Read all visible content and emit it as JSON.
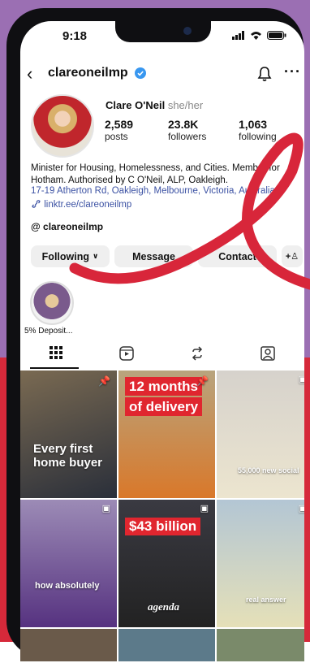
{
  "status_bar": {
    "time": "9:18"
  },
  "header": {
    "username": "clareoneilmp"
  },
  "profile": {
    "display_name": "Clare O'Neil",
    "pronouns": "she/her",
    "posts_count": "2,589",
    "posts_label": "posts",
    "followers_count": "23.8K",
    "followers_label": "followers",
    "following_count": "1,063",
    "following_label": "following",
    "bio_line1": "Minister for Housing, Homelessness, and Cities. Member for",
    "bio_line2": "Hotham. Authorised by C O'Neil, ALP, Oakleigh.",
    "address": "17-19 Atherton Rd, Oakleigh, Melbourne, Victoria, Australia",
    "link": "linktr.ee/clareoneilmp",
    "threads_handle": "clareoneilmp"
  },
  "buttons": {
    "following": "Following",
    "message": "Message",
    "contact": "Contact"
  },
  "highlights": [
    {
      "label": "5% Deposit..."
    }
  ],
  "posts": [
    {
      "caption": "Every first home buyer",
      "badge": "pin",
      "colors": [
        "#6b5a46",
        "#2a2f3a"
      ]
    },
    {
      "caption_box1": "12 months",
      "caption_box2": "of delivery",
      "badge": "pin",
      "colors": [
        "#c9a36a",
        "#e85d1e"
      ]
    },
    {
      "caption": "55,000 new social",
      "badge": "reel",
      "colors": [
        "#d9d5cf",
        "#efe9d6"
      ]
    },
    {
      "caption": "how absolutely",
      "badge": "reel",
      "colors": [
        "#8c7aa8",
        "#5c3a86"
      ]
    },
    {
      "caption_box1": "$43 billion",
      "caption2": "agenda",
      "badge": "reel",
      "colors": [
        "#2b2b30",
        "#3a3a42"
      ]
    },
    {
      "caption": "real answer",
      "badge": "reel",
      "colors": [
        "#b9cbd8",
        "#e6e2bd"
      ]
    }
  ],
  "colors": {
    "accent_red": "#e0262f",
    "link_blue": "#3b51a3",
    "verified_blue": "#3897f0"
  }
}
